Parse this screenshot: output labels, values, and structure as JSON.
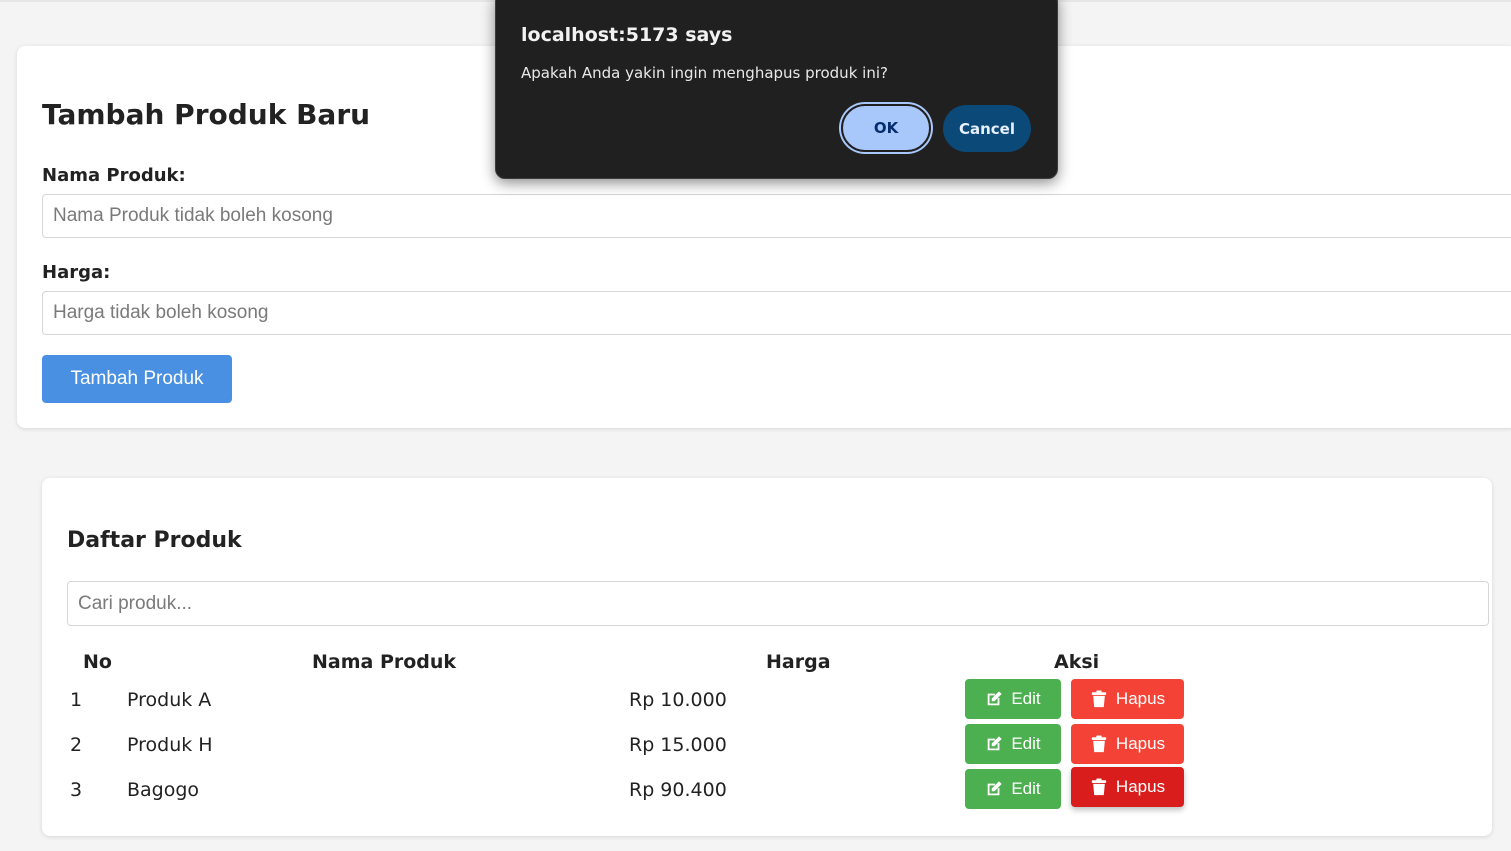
{
  "add_form": {
    "title": "Tambah Produk Baru",
    "name_label": "Nama Produk:",
    "name_placeholder": "Nama Produk tidak boleh kosong",
    "price_label": "Harga:",
    "price_placeholder": "Harga tidak boleh kosong",
    "submit_label": "Tambah Produk"
  },
  "list": {
    "title": "Daftar Produk",
    "search_placeholder": "Cari produk...",
    "columns": [
      "No",
      "Nama Produk",
      "Harga",
      "Aksi"
    ],
    "rows": [
      {
        "no": "1",
        "name": "Produk A",
        "price": "Rp 10.000",
        "edit_label": "Edit",
        "delete_label": "Hapus"
      },
      {
        "no": "2",
        "name": "Produk H",
        "price": "Rp 15.000",
        "edit_label": "Edit",
        "delete_label": "Hapus"
      },
      {
        "no": "3",
        "name": "Bagogo",
        "price": "Rp 90.400",
        "edit_label": "Edit",
        "delete_label": "Hapus"
      }
    ]
  },
  "dialog": {
    "title": "localhost:5173 says",
    "message": "Apakah Anda yakin ingin menghapus produk ini?",
    "ok_label": "OK",
    "cancel_label": "Cancel"
  },
  "icons": {
    "edit": "edit-icon",
    "delete": "trash-icon"
  },
  "colors": {
    "primary": "#4a90e2",
    "edit": "#4caf50",
    "delete": "#f44336",
    "delete_active": "#d91c1c",
    "dialog_bg": "#202020",
    "ok": "#a8c7fa",
    "cancel": "#0b4a78"
  }
}
